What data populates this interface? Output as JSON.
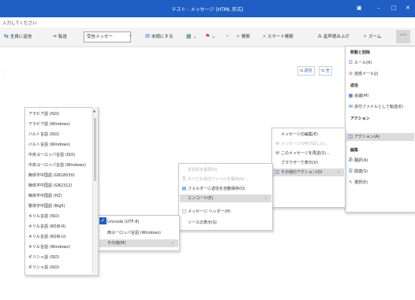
{
  "title": "テスト - メッセージ (HTML 形式)",
  "info_text": "入力してください",
  "ribbon": {
    "reply_all": "全員に返信",
    "forward": "転送",
    "move_box": "受信メッセー",
    "unread": "未読にする",
    "search": "検索",
    "smart_search": "スマート検索",
    "read_aloud": "音声読み上げ",
    "zoom": "ズーム",
    "more": "···"
  },
  "mini_buttons": [
    "返信",
    "全"
  ],
  "overflow_menu": {
    "sections": [
      {
        "header": "移動と削除",
        "items": [
          "ルール(R)",
          "迷惑メール(J)"
        ]
      },
      {
        "header": "返信",
        "items": [
          "会議(M)",
          "添付ファイルとして転送(E)"
        ]
      },
      {
        "header": "アクション",
        "items": [
          "アクション(A)"
        ]
      },
      {
        "header": "編集",
        "items": [
          "翻訳(A)",
          "関連(S)",
          "選択(E)"
        ]
      }
    ]
  },
  "action_menu": {
    "items": [
      "メッセージの編集(E)",
      "メッセージの呼び出し(I)...",
      "このメッセージを再送(S)...",
      "ブラウザーで表示(V)",
      "その他のアクション(O)"
    ],
    "disabled": [
      false,
      true,
      false,
      false,
      false
    ]
  },
  "other_actions_menu": {
    "items": [
      "反対票を投票(D)",
      "すべての添付ファイルを保存(A)...",
      "フォルダーに返信を自動保存(D)",
      "エンコード(E)",
      "メッセージ ヘッダー(H)",
      "ソースの表示(S)"
    ],
    "disabled": [
      true,
      true,
      false,
      false,
      false,
      false
    ]
  },
  "encoding_menu": {
    "items": [
      "Unicode (UTF-8)",
      "西ヨーロッパ言語 (Windows)",
      "その他(M)"
    ],
    "checked": "Unicode (UTF-8)"
  },
  "encoding_list": {
    "items": [
      "アラビア語 (ISO)",
      "アラビア語 (Windows)",
      "バルト言語 (ISO)",
      "バルト言語 (Windows)",
      "中央ヨーロッパ言語 (ISO)",
      "中央ヨーロッパ言語 (Windows)",
      "簡体字中国語 (GB18030)",
      "簡体字中国語 (GB2312)",
      "簡体字中国語 (HZ)",
      "繁体字中国語 (Big5)",
      "キリル言語 (ISO)",
      "キリル言語 (KOI8-R)",
      "キリル言語 (KOI8-U)",
      "キリル言語 (Windows)",
      "ギリシャ語 (ISO)",
      "ギリシャ語 (ISO)"
    ]
  }
}
